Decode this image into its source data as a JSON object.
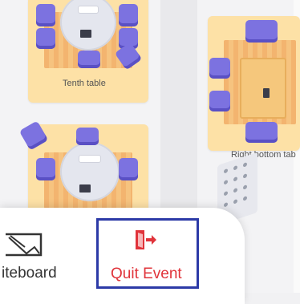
{
  "map": {
    "tables": [
      {
        "label": "Tenth table"
      },
      {
        "label": "Right bottom tab"
      }
    ]
  },
  "bottom_panel": {
    "whiteboard_label": "iteboard",
    "quit_label": "Quit Event"
  },
  "colors": {
    "accent_box": "#2c3aa7",
    "quit_red": "#e0333a",
    "chair_purple": "#7c72e0",
    "tile_yellow": "#fde1a6"
  },
  "icons": {
    "whiteboard": "whiteboard-icon",
    "quit": "exit-door-icon"
  }
}
